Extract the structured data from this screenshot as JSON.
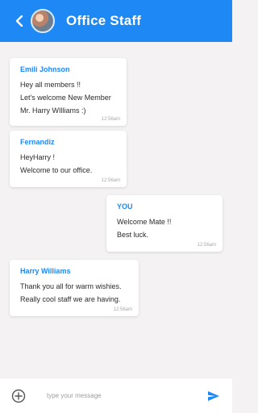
{
  "header": {
    "title": "Office Staff",
    "back_icon": "chevron-left-icon",
    "avatar": "group-avatar",
    "background": "#1e88f5"
  },
  "messages": [
    {
      "sender": "Emili Johnson",
      "lines": [
        "Hey all members !!",
        "Let's welcome New Member",
        "Mr. Harry WIlliams :)"
      ],
      "time": "12:56am",
      "mine": false
    },
    {
      "sender": "Fernandiz",
      "lines": [
        "HeyHarry !",
        "Welcome to our office."
      ],
      "time": "12:56am",
      "mine": false
    },
    {
      "sender": "YOU",
      "lines": [
        "Welcome Mate !!",
        "Best luck."
      ],
      "time": "12:56am",
      "mine": true
    },
    {
      "sender": "Harry Williams",
      "lines": [
        "Thank you all for warm wishies.",
        "Really cool staff we are having."
      ],
      "time": "12:56am",
      "mine": false
    }
  ],
  "composer": {
    "placeholder": "type your message",
    "value": "",
    "add_icon": "add-circle-icon",
    "send_icon": "send-icon"
  }
}
